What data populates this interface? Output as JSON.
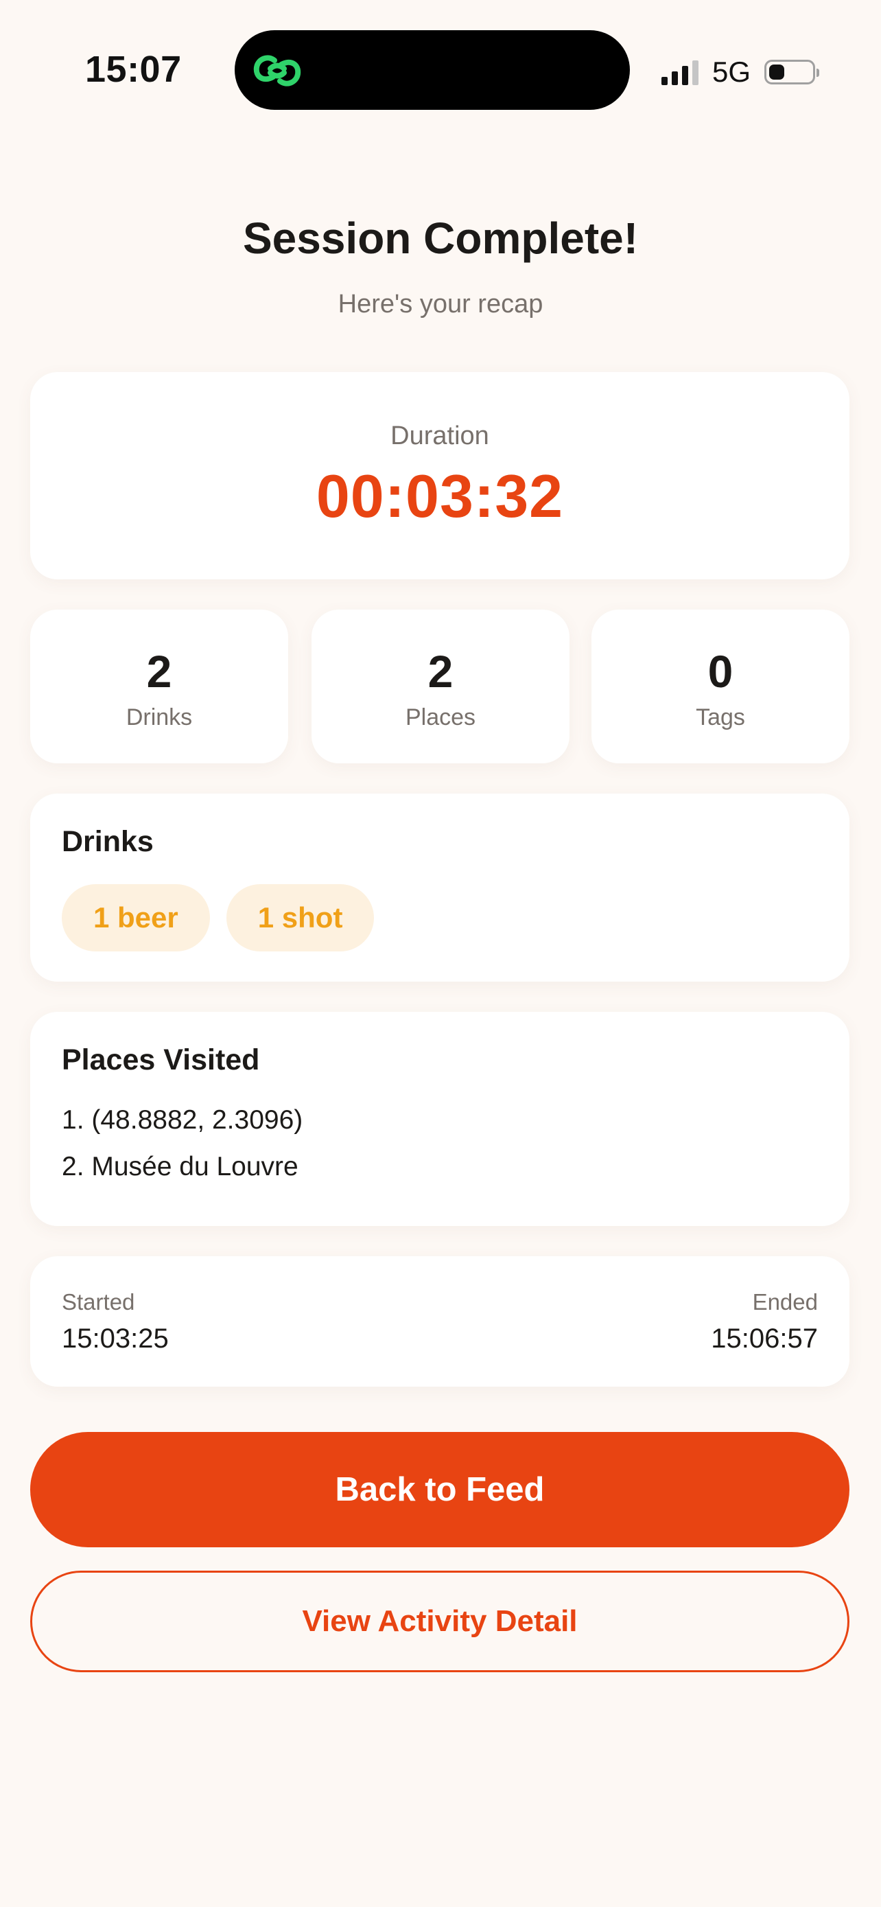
{
  "status_bar": {
    "time": "15:07",
    "network": "5G",
    "app_icon": "link-icon",
    "accent_green": "#2fd36a"
  },
  "header": {
    "title": "Session Complete!",
    "subtitle": "Here's your recap"
  },
  "duration": {
    "label": "Duration",
    "value": "00:03:32"
  },
  "stats": [
    {
      "value": "2",
      "label": "Drinks"
    },
    {
      "value": "2",
      "label": "Places"
    },
    {
      "value": "0",
      "label": "Tags"
    }
  ],
  "drinks": {
    "title": "Drinks",
    "chips": [
      "1 beer",
      "1 shot"
    ]
  },
  "places": {
    "title": "Places Visited",
    "items": [
      "1. (48.8882, 2.3096)",
      "2. Musée du Louvre"
    ]
  },
  "times": {
    "started_label": "Started",
    "started_value": "15:03:25",
    "ended_label": "Ended",
    "ended_value": "15:06:57"
  },
  "actions": {
    "primary_label": "Back to Feed",
    "secondary_label": "View Activity Detail"
  },
  "colors": {
    "accent": "#e84412",
    "background": "#fdf8f4",
    "chip_bg": "#fdf1df",
    "chip_text": "#f0a018"
  }
}
